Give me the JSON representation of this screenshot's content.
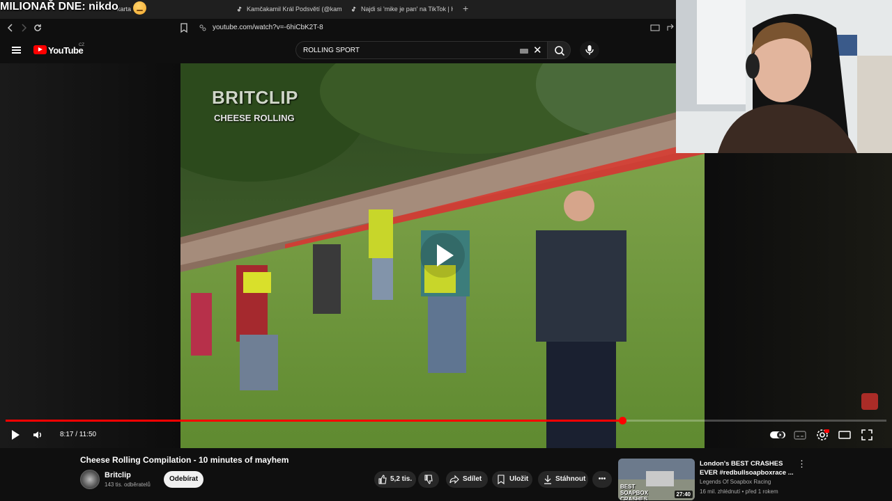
{
  "overlay": {
    "title": "MILIONAŘ DNE: nikdo"
  },
  "browser": {
    "tabs": [
      {
        "label": "karta"
      },
      {
        "label": "Kamčakamil Král Podsvětí (@kamcak"
      },
      {
        "label": "Najdi si 'mike je pan' na TikTok | Hled"
      }
    ],
    "new_tab": "+",
    "url": "youtube.com/watch?v=-6hiCbK2T-8"
  },
  "youtube": {
    "logo_text": "YouTube",
    "country": "CZ",
    "search_value": "ROLLING SPORT"
  },
  "video": {
    "watermark_title": "BRITCLIP",
    "watermark_subtitle": "CHEESE ROLLING",
    "current_time": "8:17",
    "duration": "11:50",
    "time_display": "8:17 / 11:50",
    "progress_fraction": 0.7
  },
  "info": {
    "title": "Cheese Rolling Compilation - 10 minutes of mayhem",
    "channel": "Britclip",
    "subscribers": "143 tis. odběratelů",
    "subscribe_label": "Odebírat",
    "likes": "5,2 tis.",
    "share_label": "Sdílet",
    "save_label": "Uložit",
    "download_label": "Stáhnout"
  },
  "recommended": {
    "title": "London's BEST CRASHES EVER #redbullsoapboxrace ...",
    "channel": "Legends Of Soapbox Racing",
    "meta": "16 mil. zhlédnutí • před 1 rokem",
    "duration": "27:40",
    "thumb_text": "BEST SOAPBOX CRASHES"
  },
  "colors": {
    "accent": "#ff0000",
    "background": "#0f0f0f"
  }
}
